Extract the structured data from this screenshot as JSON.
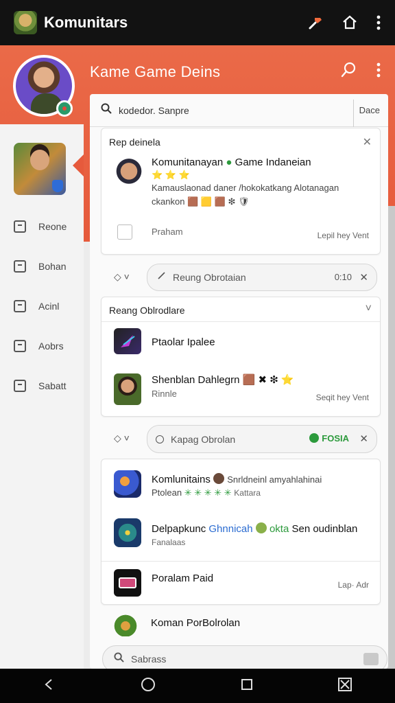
{
  "app": {
    "title": "Komunitars"
  },
  "header": {
    "title": "Kame Game Deins"
  },
  "search": {
    "text": "kodedor. Sanpre",
    "right_label": "Dace"
  },
  "sidebar": {
    "items": [
      {
        "label": "Reone"
      },
      {
        "label": "Bohan"
      },
      {
        "label": "Acinl"
      },
      {
        "label": "Aobrs"
      },
      {
        "label": "Sabatt"
      }
    ]
  },
  "card1": {
    "title": "Rep deinela",
    "name": "Komunitanayan",
    "name_tail": "Game Indaneian",
    "stars": "⭐ ⭐ ⭐",
    "desc": "Kamauslaonad daner /hokokatkang Alotanagan",
    "desc2": "ckankon",
    "desc2_icons": "🟫 🟨 🟫 ❇ 🛡",
    "footer_left": "Praham",
    "footer_right": "Lepil hey Vent"
  },
  "pill1": {
    "placeholder": "Reung Obrotaian",
    "count": "0:10"
  },
  "card2": {
    "title": "Reang Oblrodlare",
    "items": [
      {
        "name": "Ptaolar Ipalee"
      },
      {
        "name": "Shenblan Dahlegrn",
        "icons": "🟫 ✖ ❇ ⭐",
        "sub": "Rinnle",
        "right": "Seqit hey Vent"
      }
    ]
  },
  "pill2": {
    "placeholder": "Kapag Obrolan",
    "status": "FOSIA"
  },
  "card3": {
    "items": [
      {
        "name": "Komlunitains",
        "name_tail": "Snrldneinl amyahlahinai",
        "sub": "Ptolean",
        "sub_icons": "✳ ✳ ✳ ✳ ✳",
        "sub_tail": "Kattara"
      },
      {
        "name": "Delpapkunc",
        "name_green": "Ghnnicah",
        "name_green2": "okta",
        "name_tail": "Sen oudinblan",
        "sub": "Fanalaas"
      },
      {
        "name": "Poralam Paid",
        "right": "Lap· Adr"
      }
    ]
  },
  "card4": {
    "name": "Koman PorBolrolan"
  },
  "bottom": {
    "placeholder": "Sabrass"
  }
}
